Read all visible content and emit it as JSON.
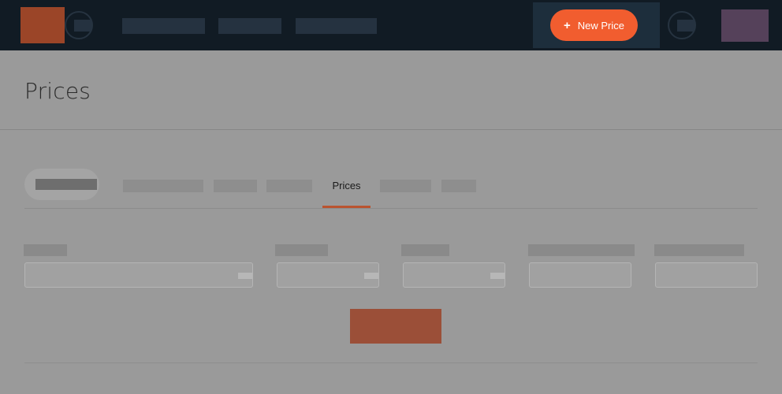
{
  "header": {
    "new_price_button": {
      "label": "New Price",
      "icon": "plus-icon",
      "bg_color": "#f15d2f"
    }
  },
  "page": {
    "title": "Prices"
  },
  "tabs": {
    "active": "Prices",
    "accent_color": "#ba5430"
  }
}
